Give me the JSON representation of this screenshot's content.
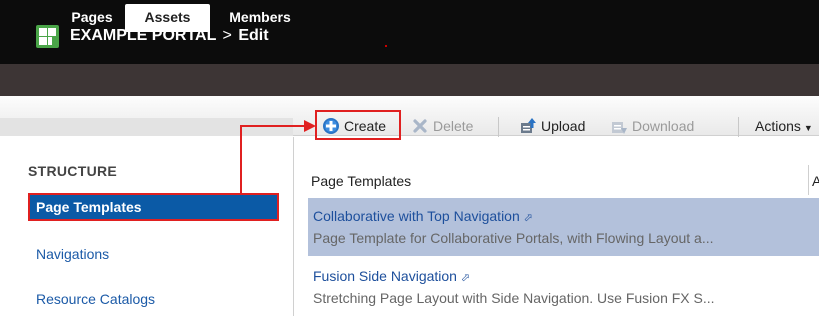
{
  "header": {
    "portal_name": "EXAMPLE PORTAL",
    "separator": ">",
    "mode": "Edit"
  },
  "tabs": [
    {
      "label": "Pages",
      "active": false
    },
    {
      "label": "Assets",
      "active": true
    },
    {
      "label": "Members",
      "active": false
    }
  ],
  "toolbar": {
    "create_label": "Create",
    "delete_label": "Delete",
    "upload_label": "Upload",
    "download_label": "Download",
    "actions_label": "Actions"
  },
  "sidebar": {
    "heading": "STRUCTURE",
    "items": [
      {
        "label": "Page Templates",
        "selected": true
      },
      {
        "label": "Navigations",
        "selected": false
      },
      {
        "label": "Resource Catalogs",
        "selected": false
      }
    ]
  },
  "main": {
    "column_header": "Page Templates",
    "column_header_2": "A",
    "rows": [
      {
        "title": "Collaborative with Top Navigation",
        "description": "Page Template for Collaborative Portals, with Flowing Layout a...",
        "selected": true
      },
      {
        "title": "Fusion Side Navigation",
        "description": "Stretching Page Layout with Side Navigation. Use Fusion FX S...",
        "selected": false
      }
    ]
  },
  "colors": {
    "accent_green": "#4aa548",
    "selection_blue": "#0b5aa6",
    "row_highlight": "#b3c1db",
    "annotation_red": "#e02020",
    "link_blue": "#1d4f9c"
  },
  "icons": [
    "portal-logo-icon",
    "gear-create-icon",
    "delete-x-icon",
    "upload-icon",
    "download-icon",
    "chevron-down-icon",
    "external-link-icon"
  ]
}
